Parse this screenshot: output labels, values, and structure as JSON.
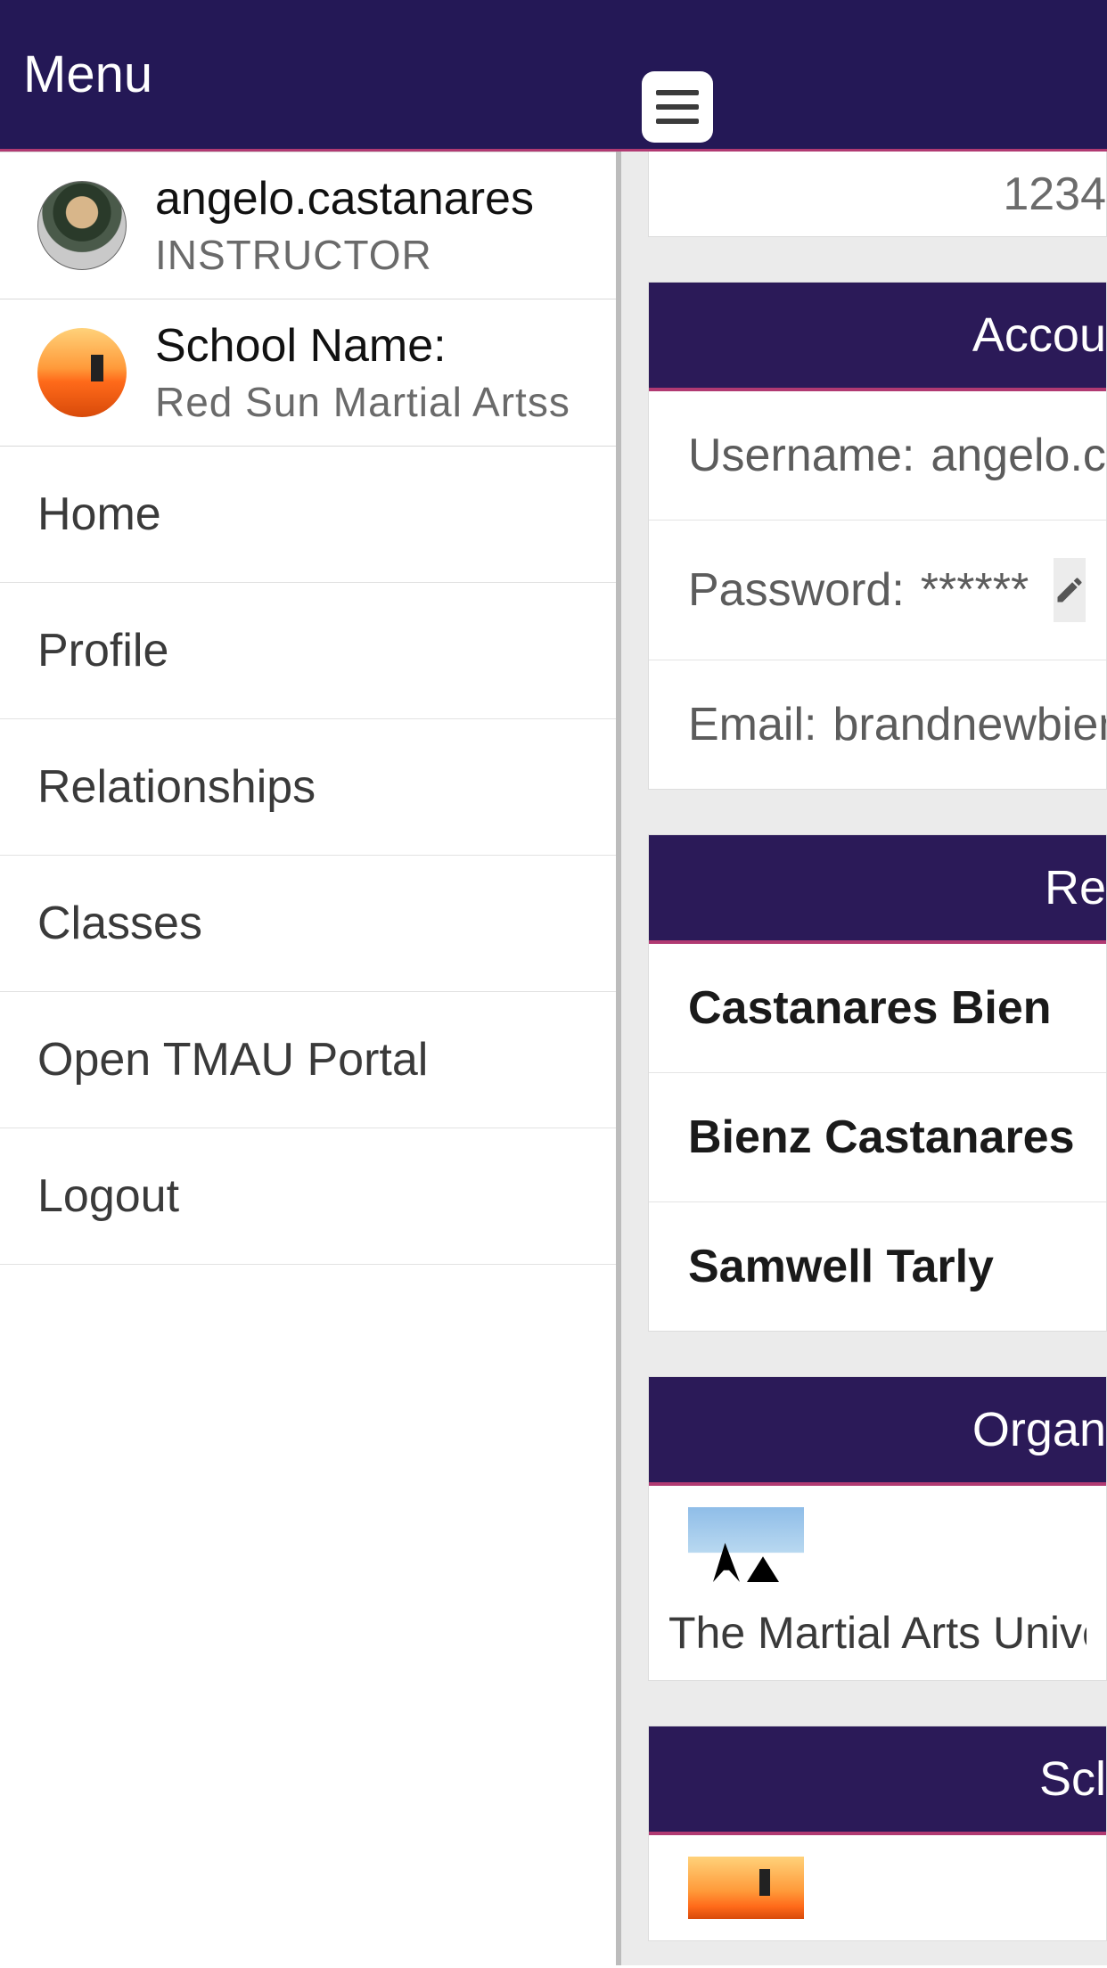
{
  "header": {
    "title": "Menu"
  },
  "sidebar": {
    "user": {
      "name": "angelo.castanares",
      "role": "INSTRUCTOR"
    },
    "school": {
      "label": "School Name:",
      "value": "Red Sun Martial Artss"
    },
    "nav": [
      {
        "label": "Home"
      },
      {
        "label": "Profile"
      },
      {
        "label": "Relationships"
      },
      {
        "label": "Classes"
      },
      {
        "label": "Open TMAU Portal"
      },
      {
        "label": "Logout"
      }
    ]
  },
  "content": {
    "top_fragment": "1234",
    "account": {
      "header": "Accou",
      "username_label": "Username: ",
      "username_value": "angelo.castar",
      "password_label": "Password: ",
      "password_value": "******",
      "email_label": "Email: ",
      "email_value": "brandnewbien@gr"
    },
    "relationships": {
      "header": "Re",
      "items": [
        "Castanares Bien",
        "Bienz Castanares",
        "Samwell Tarly"
      ]
    },
    "organization": {
      "header": "Organ",
      "caption": "The Martial Arts Universi"
    },
    "school_section": {
      "header": "Scl"
    }
  }
}
